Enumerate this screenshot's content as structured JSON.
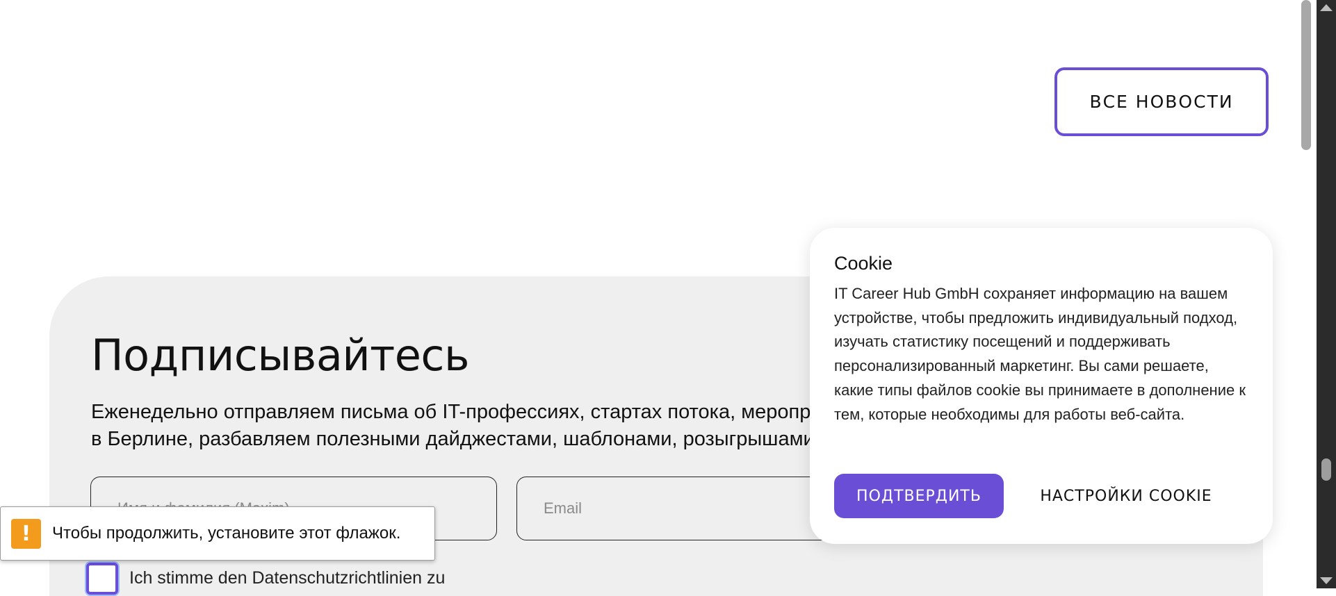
{
  "news": {
    "all_news_label": "ВСЕ НОВОСТИ"
  },
  "subscribe": {
    "title": "Подписывайтесь",
    "description": "Еженедельно отправляем письма об IT-профессиях, стартах потока, мероприятиях в Берлине, разбавляем полезными дайджестами, шаблонами, розыгрышами",
    "name_placeholder": "Имя и фамилия (Maxim)",
    "email_placeholder": "Email",
    "consent_label": "Ich stimme den Datenschutzrichtlinien zu"
  },
  "validation_tooltip": {
    "icon": "warning-icon",
    "text": "Чтобы продолжить, установите этот флажок."
  },
  "cookie_banner": {
    "title": "Cookie",
    "text": "IT Career Hub GmbH сохраняет информацию на вашем устройстве, чтобы предложить индивидуальный подход, изучать статистику посещений и поддерживать персонализированный маркетинг. Вы сами решаете, какие типы файлов cookie вы принимаете в дополнение к тем, которые необходимы для работы веб-сайта.",
    "confirm_label": "ПОДТВЕРДИТЬ",
    "settings_label": "НАСТРОЙКИ COOKIE"
  },
  "colors": {
    "accent": "#6a4fd6",
    "section_bg": "#efefef",
    "warning": "#f29b1d"
  }
}
